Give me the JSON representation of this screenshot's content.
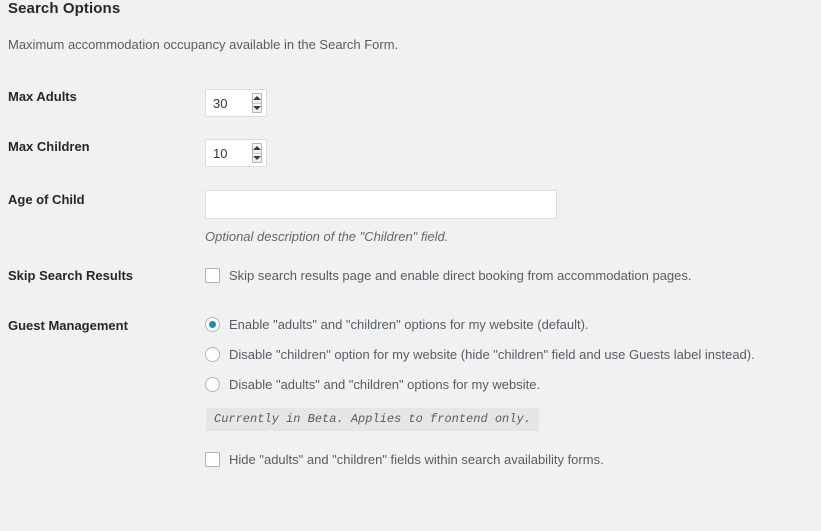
{
  "section": {
    "title": "Search Options",
    "description": "Maximum accommodation occupancy available in the Search Form."
  },
  "fields": {
    "max_adults": {
      "label": "Max Adults",
      "value": "30",
      "spinner_up_icon": "triangle-up-icon",
      "spinner_down_icon": "triangle-down-icon"
    },
    "max_children": {
      "label": "Max Children",
      "value": "10",
      "spinner_up_icon": "triangle-up-icon",
      "spinner_down_icon": "triangle-down-icon"
    },
    "age_of_child": {
      "label": "Age of Child",
      "value": "",
      "placeholder": "",
      "description": "Optional description of the \"Children\" field."
    },
    "skip_search_results": {
      "label": "Skip Search Results",
      "checkbox_label": "Skip search results page and enable direct booking from accommodation pages.",
      "checked": false
    },
    "guest_management": {
      "label": "Guest Management",
      "options": [
        {
          "label": "Enable \"adults\" and \"children\" options for my website (default).",
          "selected": true
        },
        {
          "label": "Disable \"children\" option for my website (hide \"children\" field and use Guests label instead).",
          "selected": false
        },
        {
          "label": "Disable \"adults\" and \"children\" options for my website.",
          "selected": false
        }
      ],
      "beta_note": "Currently in Beta. Applies to frontend only.",
      "hide_fields_checkbox": {
        "label": "Hide \"adults\" and \"children\" fields within search availability forms.",
        "checked": false
      }
    }
  },
  "colors": {
    "page_background": "#f1f1f1",
    "label_text": "#23282d",
    "body_text": "#555d66",
    "accent_radio": "#1e8cbe",
    "input_border": "#dedede",
    "beta_background": "#e6e6e6"
  }
}
